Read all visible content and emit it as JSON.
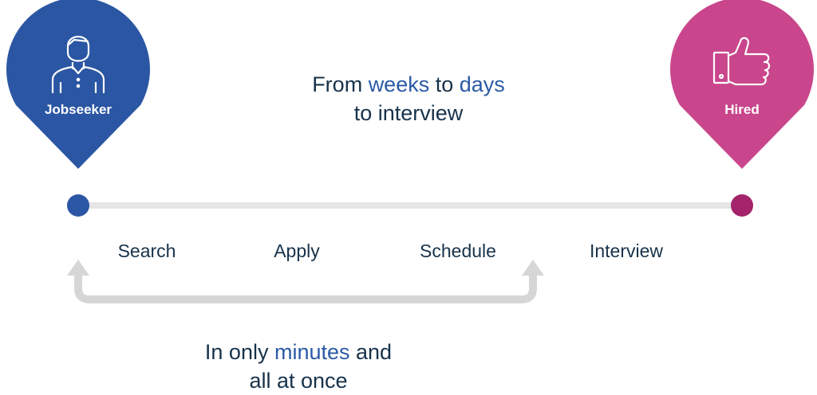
{
  "colors": {
    "jobseeker_pin": "#2b56a3",
    "hired_pin": "#c9468c",
    "start_dot": "#2b56a3",
    "end_dot": "#a3246a",
    "track": "#e5e5e5",
    "loop_arrow": "#d6d6d6",
    "text_dark": "#17324a",
    "text_accent": "#2b5aa6"
  },
  "start_pin": {
    "label": "Jobseeker",
    "icon": "person-icon"
  },
  "end_pin": {
    "label": "Hired",
    "icon": "thumbs-up-icon"
  },
  "headline": {
    "part1": "From ",
    "accent1": "weeks",
    "part2": " to ",
    "accent2": "days",
    "line2": "to interview"
  },
  "stages": [
    "Search",
    "Apply",
    "Schedule",
    "Interview"
  ],
  "footer": {
    "part1": "In only ",
    "accent": "minutes",
    "part2": " and",
    "line2": "all at once"
  }
}
